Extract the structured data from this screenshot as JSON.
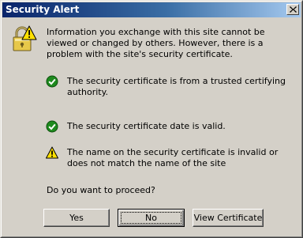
{
  "window": {
    "title": "Security Alert"
  },
  "intro_text": "Information you exchange with this site cannot be viewed or changed by others. However, there is a problem with the site's security certificate.",
  "checks": [
    {
      "status": "ok",
      "icon": "green-check-icon",
      "text": "The security certificate is from a trusted certifying authority."
    },
    {
      "status": "ok",
      "icon": "green-check-icon",
      "text": "The security certificate date is valid."
    },
    {
      "status": "warning",
      "icon": "yellow-warning-icon",
      "text": "The name on the security certificate is invalid or does not match the name of the site"
    }
  ],
  "question": "Do you want to proceed?",
  "buttons": {
    "yes": "Yes",
    "no": "No",
    "view_certificate": "View Certificate"
  },
  "colors": {
    "title_start": "#0a246a",
    "title_end": "#a6caf0",
    "dialog_bg": "#d4d0c8",
    "ok_green": "#1e8a1e",
    "warning_yellow": "#ffe000"
  }
}
